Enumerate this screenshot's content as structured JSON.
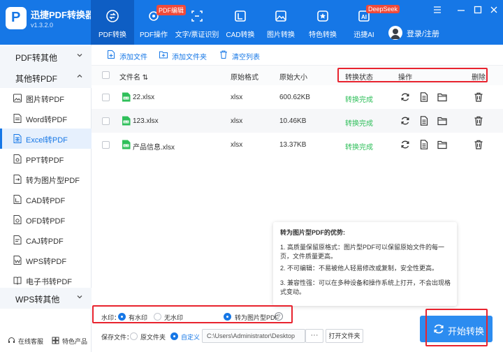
{
  "app": {
    "name": "迅捷PDF转换器",
    "version": "v1.3.2.0"
  },
  "nav": [
    {
      "label": "PDF转换",
      "badge": ""
    },
    {
      "label": "PDF操作",
      "badge": "PDF编辑"
    },
    {
      "label": "文字/票证识别",
      "badge": ""
    },
    {
      "label": "CAD转换",
      "badge": ""
    },
    {
      "label": "图片转换",
      "badge": ""
    },
    {
      "label": "特色转换",
      "badge": ""
    },
    {
      "label": "迅捷AI",
      "badge": "DeepSeek"
    }
  ],
  "user": {
    "label": "登录/注册"
  },
  "sidebar": {
    "cat1": "PDF转其他",
    "cat2": "其他转PDF",
    "cat3": "WPS转其他",
    "items": [
      "图片转PDF",
      "Word转PDF",
      "Excel转PDF",
      "PPT转PDF",
      "转为图片型PDF",
      "CAD转PDF",
      "OFD转PDF",
      "CAJ转PDF",
      "WPS转PDF",
      "电子书转PDF"
    ],
    "footer": {
      "service": "在线客服",
      "products": "特色产品"
    }
  },
  "toolbar": {
    "add_file": "添加文件",
    "add_folder": "添加文件夹",
    "clear": "清空列表"
  },
  "table": {
    "headers": {
      "name": "文件名",
      "format": "原始格式",
      "size": "原始大小",
      "status": "转换状态",
      "actions": "操作",
      "delete": "删除"
    },
    "rows": [
      {
        "name": "22.xlsx",
        "format": "xlsx",
        "size": "600.62KB",
        "status": "转换完成"
      },
      {
        "name": "123.xlsx",
        "format": "xlsx",
        "size": "10.46KB",
        "status": "转换完成"
      },
      {
        "name": "产品信息.xlsx",
        "format": "xlsx",
        "size": "13.37KB",
        "status": "转换完成"
      }
    ]
  },
  "advantage": {
    "title": "转为图片型PDF的优势:",
    "p1": "1. 高质量保留原格式：图片型PDF可以保留原始文件的每一页，文件质量更高。",
    "p2": "2. 不可编辑：不易被他人轻易修改或复制，安全性更高。",
    "p3": "3. 兼容性强：可以在多种设备和操作系统上打开，不会出现格式变动。"
  },
  "options": {
    "watermark_label": "水印：",
    "with_watermark": "有水印",
    "no_watermark": "无水印",
    "to_image_pdf": "转为图片型PDF",
    "help": "?",
    "save_label": "保存文件：",
    "original_folder": "原文件夹",
    "custom": "自定义",
    "path": "C:\\Users\\Administrator\\Desktop",
    "dots": "···",
    "open_folder": "打开文件夹"
  },
  "start_button": "开始转换",
  "colors": {
    "brand": "#1677e6",
    "status_ok": "#2fbf5a",
    "highlight": "#e8232e",
    "badge": "#f04a3a"
  }
}
